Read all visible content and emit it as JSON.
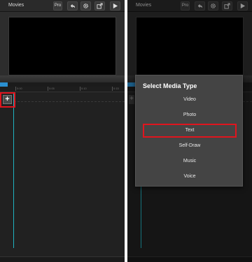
{
  "app": {
    "title": "Movies",
    "pro_label": "Pro"
  },
  "toolbar": {
    "undo_icon": "undo-icon",
    "settings_icon": "gear-icon",
    "export_icon": "export-icon",
    "play_icon": "play-icon"
  },
  "playback": {
    "progress_fraction": 0.06
  },
  "ruler": {
    "ticks": [
      "0:00",
      "0:05",
      "0:10",
      "0:15"
    ]
  },
  "timeline": {
    "add_label": "+"
  },
  "dialog": {
    "title": "Select Media Type",
    "options": [
      "Video",
      "Photo",
      "Text",
      "Self-Draw",
      "Music",
      "Voice"
    ],
    "highlighted_option": "Text"
  },
  "colors": {
    "highlight": "#e0151e",
    "playhead": "#1fb3c0",
    "progress": "#2a8fd0"
  }
}
